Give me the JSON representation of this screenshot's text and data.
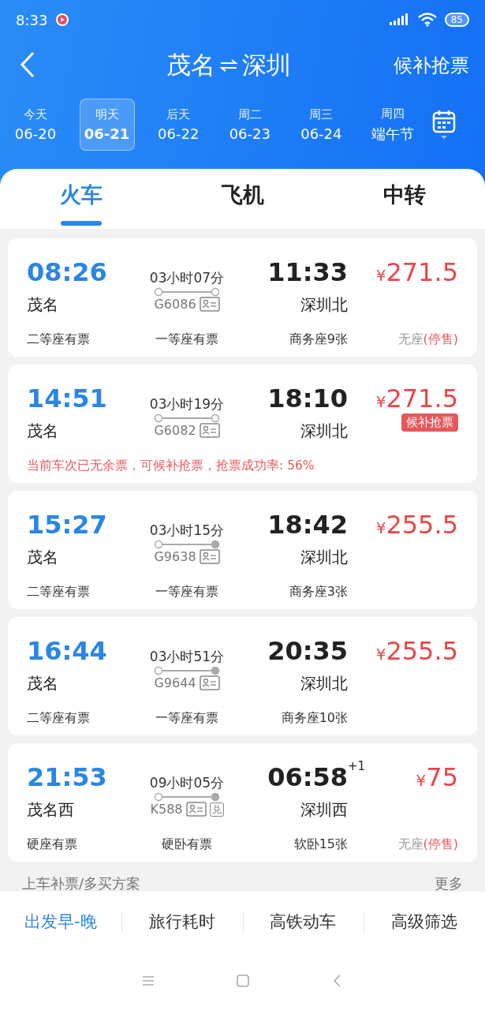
{
  "status_bar": {
    "time": "8:33",
    "battery": "85"
  },
  "header": {
    "from": "茂名",
    "to": "深圳",
    "action": "候补抢票"
  },
  "dates": [
    {
      "label": "今天",
      "date": "06-20",
      "selected": false
    },
    {
      "label": "明天",
      "date": "06-21",
      "selected": true
    },
    {
      "label": "后天",
      "date": "06-22",
      "selected": false
    },
    {
      "label": "周二",
      "date": "06-23",
      "selected": false
    },
    {
      "label": "周三",
      "date": "06-24",
      "selected": false
    },
    {
      "label": "周四",
      "date": "端午节",
      "selected": false
    }
  ],
  "tabs": [
    {
      "label": "火车",
      "selected": true
    },
    {
      "label": "飞机",
      "selected": false
    },
    {
      "label": "中转",
      "selected": false
    }
  ],
  "trains": [
    {
      "depart": "08:26",
      "from": "茂名",
      "duration": "03小时07分",
      "number": "G6086",
      "terminus": false,
      "arrive": "11:33",
      "to": "深圳北",
      "currency": "¥",
      "price": "271.5",
      "kind": "seats",
      "seats": [
        "二等座有票",
        "一等座有票",
        "商务座9张"
      ],
      "no_seat": {
        "label": "无座",
        "status": "(停售)"
      }
    },
    {
      "depart": "14:51",
      "from": "茂名",
      "duration": "03小时19分",
      "number": "G6082",
      "terminus": false,
      "arrive": "18:10",
      "to": "深圳北",
      "currency": "¥",
      "price": "271.5",
      "waitlist": "候补抢票",
      "kind": "notice",
      "notice": "当前车次已无余票，可候补抢票，抢票成功率: 56%"
    },
    {
      "depart": "15:27",
      "from": "茂名",
      "duration": "03小时15分",
      "number": "G9638",
      "terminus": true,
      "arrive": "18:42",
      "to": "深圳北",
      "currency": "¥",
      "price": "255.5",
      "kind": "seats",
      "seats": [
        "二等座有票",
        "一等座有票",
        "商务座3张"
      ]
    },
    {
      "depart": "16:44",
      "from": "茂名",
      "duration": "03小时51分",
      "number": "G9644",
      "terminus": true,
      "arrive": "20:35",
      "to": "深圳北",
      "currency": "¥",
      "price": "255.5",
      "kind": "seats",
      "seats": [
        "二等座有票",
        "一等座有票",
        "商务座10张"
      ]
    },
    {
      "depart": "21:53",
      "from": "茂名西",
      "duration": "09小时05分",
      "number": "K588",
      "tags": [
        "兑"
      ],
      "terminus": true,
      "arrive": "06:58",
      "next_day": "+1",
      "to": "深圳西",
      "currency": "¥",
      "price": "75",
      "kind": "seats",
      "seats": [
        "硬座有票",
        "硬卧有票",
        "软卧15张"
      ],
      "no_seat": {
        "label": "无座",
        "status": "(停售)"
      }
    }
  ],
  "section": {
    "title": "上车补票/多买方案",
    "more": "更多"
  },
  "filters": [
    {
      "label": "出发早-晚",
      "selected": true
    },
    {
      "label": "旅行耗时",
      "selected": false
    },
    {
      "label": "高铁动车",
      "selected": false
    },
    {
      "label": "高级筛选",
      "selected": false
    }
  ]
}
